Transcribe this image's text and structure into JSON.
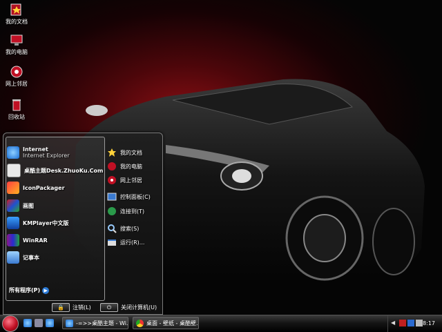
{
  "desktop": {
    "icons": [
      {
        "label": "我的文档",
        "icon": "my-documents-icon"
      },
      {
        "label": "我的电脑",
        "icon": "my-computer-icon"
      },
      {
        "label": "网上邻居",
        "icon": "network-places-icon"
      },
      {
        "label": "回收站",
        "icon": "recycle-bin-icon"
      }
    ]
  },
  "start_menu": {
    "programs": [
      {
        "label": "Internet",
        "sub": "Internet Explorer",
        "icon": "internet-explorer-icon"
      },
      {
        "label": "桌酷主题Desk.ZhuoKu.Com",
        "icon": "zhuoku-icon"
      },
      {
        "label": "IconPackager",
        "icon": "iconpackager-icon"
      },
      {
        "label": "画图",
        "icon": "paint-icon"
      },
      {
        "label": "KMPlayer中文版",
        "icon": "kmplayer-icon"
      },
      {
        "label": "WinRAR",
        "icon": "winrar-icon"
      },
      {
        "label": "记事本",
        "icon": "notepad-icon"
      }
    ],
    "all_programs": "所有程序(P)",
    "places": [
      {
        "label": "我的文档",
        "icon": "my-documents-icon"
      },
      {
        "label": "我的电脑",
        "icon": "my-computer-icon"
      },
      {
        "label": "网上邻居",
        "icon": "network-places-icon"
      },
      {
        "label": "控制面板(C)",
        "icon": "control-panel-icon"
      },
      {
        "label": "连接到(T)",
        "icon": "connect-to-icon"
      },
      {
        "label": "搜索(S)",
        "icon": "search-icon"
      },
      {
        "label": "运行(R)...",
        "icon": "run-icon"
      }
    ],
    "logoff": "注销(L)",
    "shutdown": "关闭计算机(U)"
  },
  "taskbar": {
    "tasks": [
      {
        "label": "-=>>桌酷主题 - Wi...",
        "icon": "ie-window-icon"
      },
      {
        "label": "桌面 - 壁纸 - 桌酷壁...",
        "icon": "chrome-window-icon"
      }
    ],
    "clock": "8:17"
  },
  "colors": {
    "accent": "#c01024",
    "taskbar": "#151515"
  }
}
